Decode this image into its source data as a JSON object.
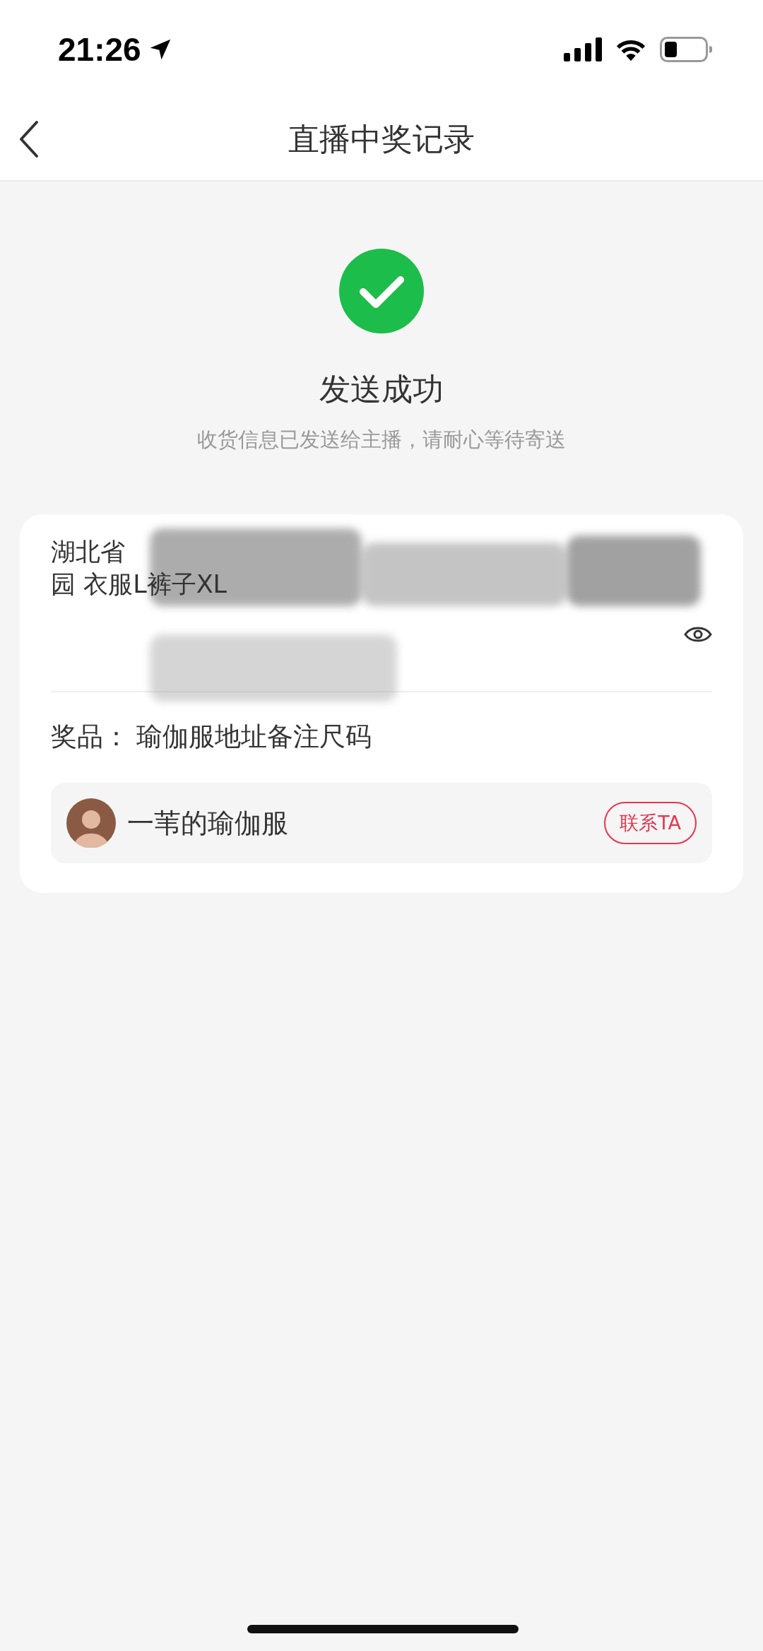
{
  "status_bar": {
    "time": "21:26"
  },
  "nav": {
    "title": "直播中奖记录"
  },
  "result": {
    "title": "发送成功",
    "subtitle": "收货信息已发送给主播，请耐心等待寄送"
  },
  "address": {
    "lines": [
      "湖北省",
      "园 衣服L裤子XL"
    ],
    "redacted": true
  },
  "prize": {
    "label": "奖品：",
    "value": "瑜伽服地址备注尺码"
  },
  "streamer": {
    "name": "一苇的瑜伽服",
    "button": "联系TA"
  }
}
